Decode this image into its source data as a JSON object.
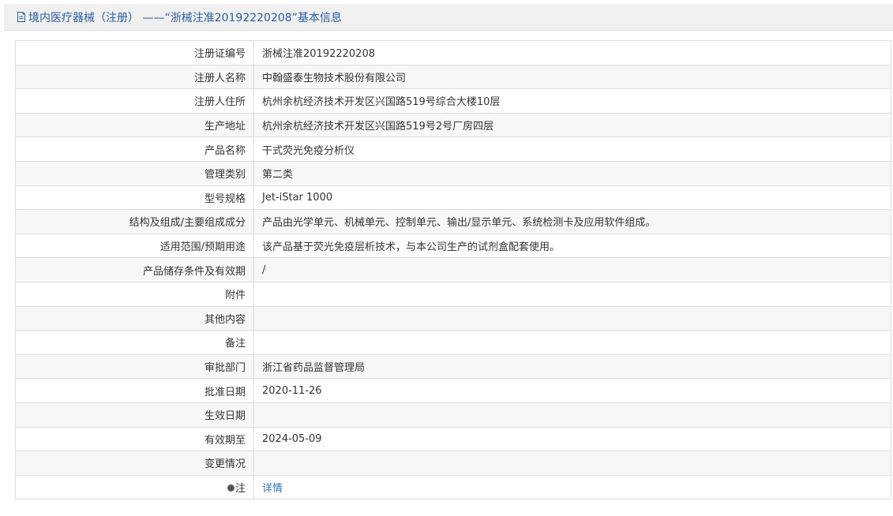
{
  "header": {
    "icon": "document-icon",
    "title": "境内医疗器械（注册） ——“浙械注准20192220208”基本信息"
  },
  "rows": [
    {
      "label": "注册证编号",
      "value": "浙械注准20192220208"
    },
    {
      "label": "注册人名称",
      "value": "中翰盛泰生物技术股份有限公司"
    },
    {
      "label": "注册人住所",
      "value": "杭州余杭经济技术开发区兴国路519号综合大楼10层"
    },
    {
      "label": "生产地址",
      "value": "杭州余杭经济技术开发区兴国路519号2号厂房四层"
    },
    {
      "label": "产品名称",
      "value": "干式荧光免疫分析仪"
    },
    {
      "label": "管理类别",
      "value": "第二类"
    },
    {
      "label": "型号规格",
      "value": "Jet-iStar 1000"
    },
    {
      "label": "结构及组成/主要组成成分",
      "value": "产品由光学单元、机械单元、控制单元、输出/显示单元、系统检测卡及应用软件组成。"
    },
    {
      "label": "适用范围/预期用途",
      "value": "该产品基于荧光免疫层析技术，与本公司生产的试剂盒配套使用。"
    },
    {
      "label": "产品储存条件及有效期",
      "value": "/"
    },
    {
      "label": "附件",
      "value": ""
    },
    {
      "label": "其他内容",
      "value": ""
    },
    {
      "label": "备注",
      "value": ""
    },
    {
      "label": "审批部门",
      "value": "浙江省药品监督管理局"
    },
    {
      "label": "批准日期",
      "value": "2020-11-26"
    },
    {
      "label": "生效日期",
      "value": ""
    },
    {
      "label": "有效期至",
      "value": "2024-05-09"
    },
    {
      "label": "变更情况",
      "value": ""
    },
    {
      "label": "注",
      "value": "详情",
      "icon": "lightbulb-icon"
    }
  ],
  "colors": {
    "title": "#2a5e9e",
    "link": "#2d73c9",
    "header_bg": "#f0f0f0",
    "border": "#dddddd",
    "row_alt": "#f7f7f7"
  }
}
